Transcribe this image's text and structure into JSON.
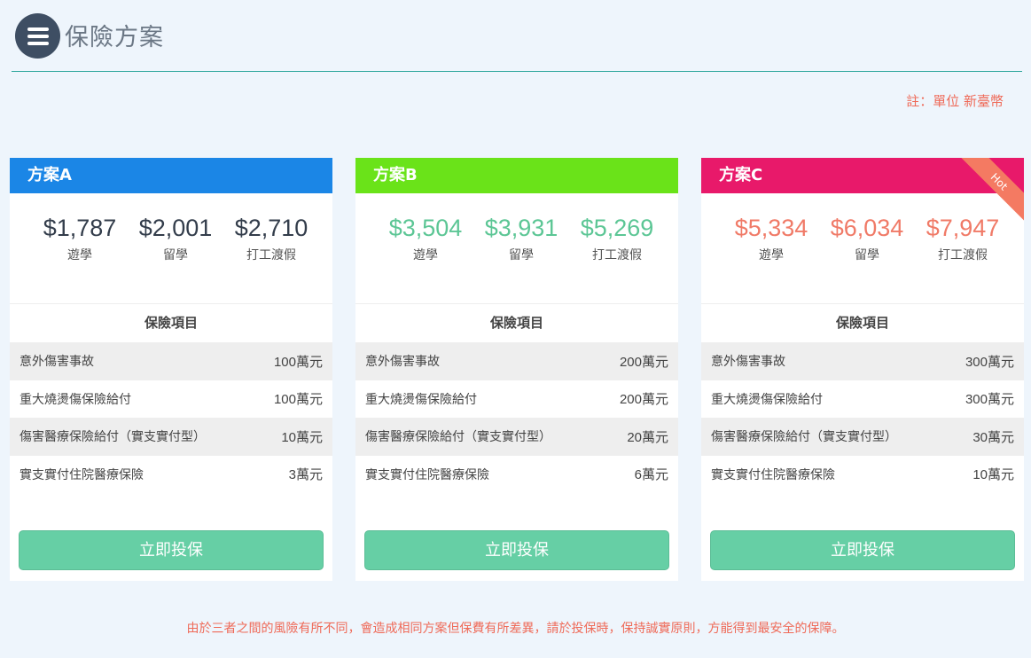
{
  "header": {
    "title": "保險方案"
  },
  "note": "註：單位 新臺幣",
  "plans": [
    {
      "name": "方案A",
      "color": "#1b86e6",
      "price_color": "#333d4b",
      "prices": [
        {
          "value": "$1,787",
          "label": "遊學"
        },
        {
          "value": "$2,001",
          "label": "留學"
        },
        {
          "value": "$2,710",
          "label": "打工渡假"
        }
      ],
      "items_title": "保險項目",
      "items": [
        {
          "name": "意外傷害事故",
          "amount": "100萬元"
        },
        {
          "name": "重大燒燙傷保險給付",
          "amount": "100萬元"
        },
        {
          "name": "傷害醫療保險給付（實支實付型）",
          "amount": "10萬元"
        },
        {
          "name": "實支實付住院醫療保險",
          "amount": "3萬元"
        }
      ],
      "button": "立即投保"
    },
    {
      "name": "方案B",
      "color": "#6ae319",
      "price_color": "#5cc695",
      "prices": [
        {
          "value": "$3,504",
          "label": "遊學"
        },
        {
          "value": "$3,931",
          "label": "留學"
        },
        {
          "value": "$5,269",
          "label": "打工渡假"
        }
      ],
      "items_title": "保險項目",
      "items": [
        {
          "name": "意外傷害事故",
          "amount": "200萬元"
        },
        {
          "name": "重大燒燙傷保險給付",
          "amount": "200萬元"
        },
        {
          "name": "傷害醫療保險給付（實支實付型）",
          "amount": "20萬元"
        },
        {
          "name": "實支實付住院醫療保險",
          "amount": "6萬元"
        }
      ],
      "button": "立即投保"
    },
    {
      "name": "方案C",
      "color": "#e8196a",
      "price_color": "#f07a67",
      "badge": "Hot",
      "prices": [
        {
          "value": "$5,334",
          "label": "遊學"
        },
        {
          "value": "$6,034",
          "label": "留學"
        },
        {
          "value": "$7,947",
          "label": "打工渡假"
        }
      ],
      "items_title": "保險項目",
      "items": [
        {
          "name": "意外傷害事故",
          "amount": "300萬元"
        },
        {
          "name": "重大燒燙傷保險給付",
          "amount": "300萬元"
        },
        {
          "name": "傷害醫療保險給付（實支實付型）",
          "amount": "30萬元"
        },
        {
          "name": "實支實付住院醫療保險",
          "amount": "10萬元"
        }
      ],
      "button": "立即投保"
    }
  ],
  "footer": "由於三者之間的風險有所不同，會造成相同方案但保費有所差異，請於投保時，保持誠實原則，方能得到最安全的保障。"
}
